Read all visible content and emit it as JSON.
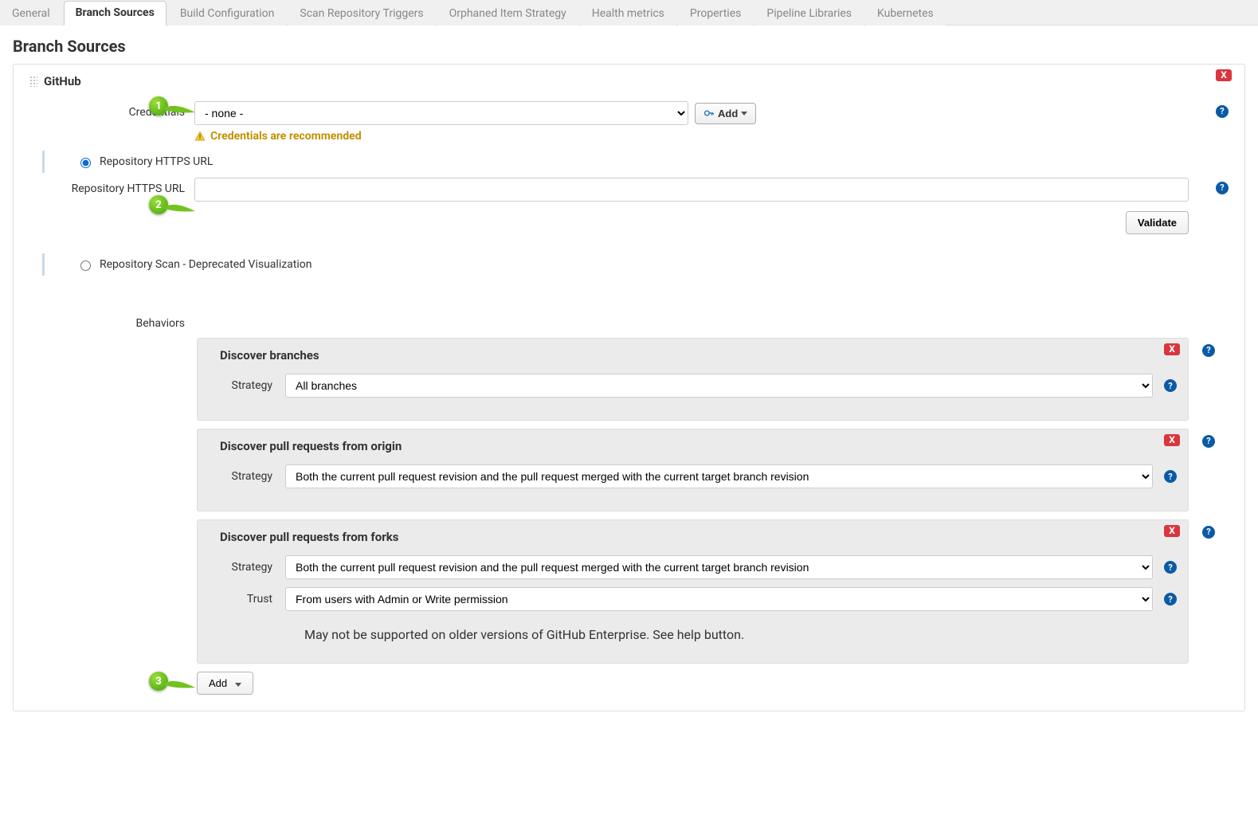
{
  "tabs": [
    "General",
    "Branch Sources",
    "Build Configuration",
    "Scan Repository Triggers",
    "Orphaned Item Strategy",
    "Health metrics",
    "Properties",
    "Pipeline Libraries",
    "Kubernetes"
  ],
  "active_tab_index": 1,
  "section_title": "Branch Sources",
  "source": {
    "title": "GitHub",
    "delete": "X",
    "credentials_label": "Credentials",
    "credentials_selected": "- none -",
    "add_button": "Add",
    "credentials_warning": "Credentials are recommended",
    "radio_https": "Repository HTTPS URL",
    "repo_url_label": "Repository HTTPS URL",
    "repo_url_value": "",
    "validate_btn": "Validate",
    "radio_deprecated": "Repository Scan - Deprecated Visualization",
    "behaviors_label": "Behaviors",
    "behaviors": [
      {
        "title": "Discover branches",
        "delete": "X",
        "rows": [
          {
            "label": "Strategy",
            "value": "All branches"
          }
        ]
      },
      {
        "title": "Discover pull requests from origin",
        "delete": "X",
        "rows": [
          {
            "label": "Strategy",
            "value": "Both the current pull request revision and the pull request merged with the current target branch revision"
          }
        ]
      },
      {
        "title": "Discover pull requests from forks",
        "delete": "X",
        "rows": [
          {
            "label": "Strategy",
            "value": "Both the current pull request revision and the pull request merged with the current target branch revision"
          },
          {
            "label": "Trust",
            "value": "From users with Admin or Write permission"
          }
        ],
        "note": "May not be supported on older versions of GitHub Enterprise. See help button."
      }
    ],
    "add_behavior": "Add"
  },
  "callouts": {
    "c1": "1",
    "c2": "2",
    "c3": "3"
  }
}
